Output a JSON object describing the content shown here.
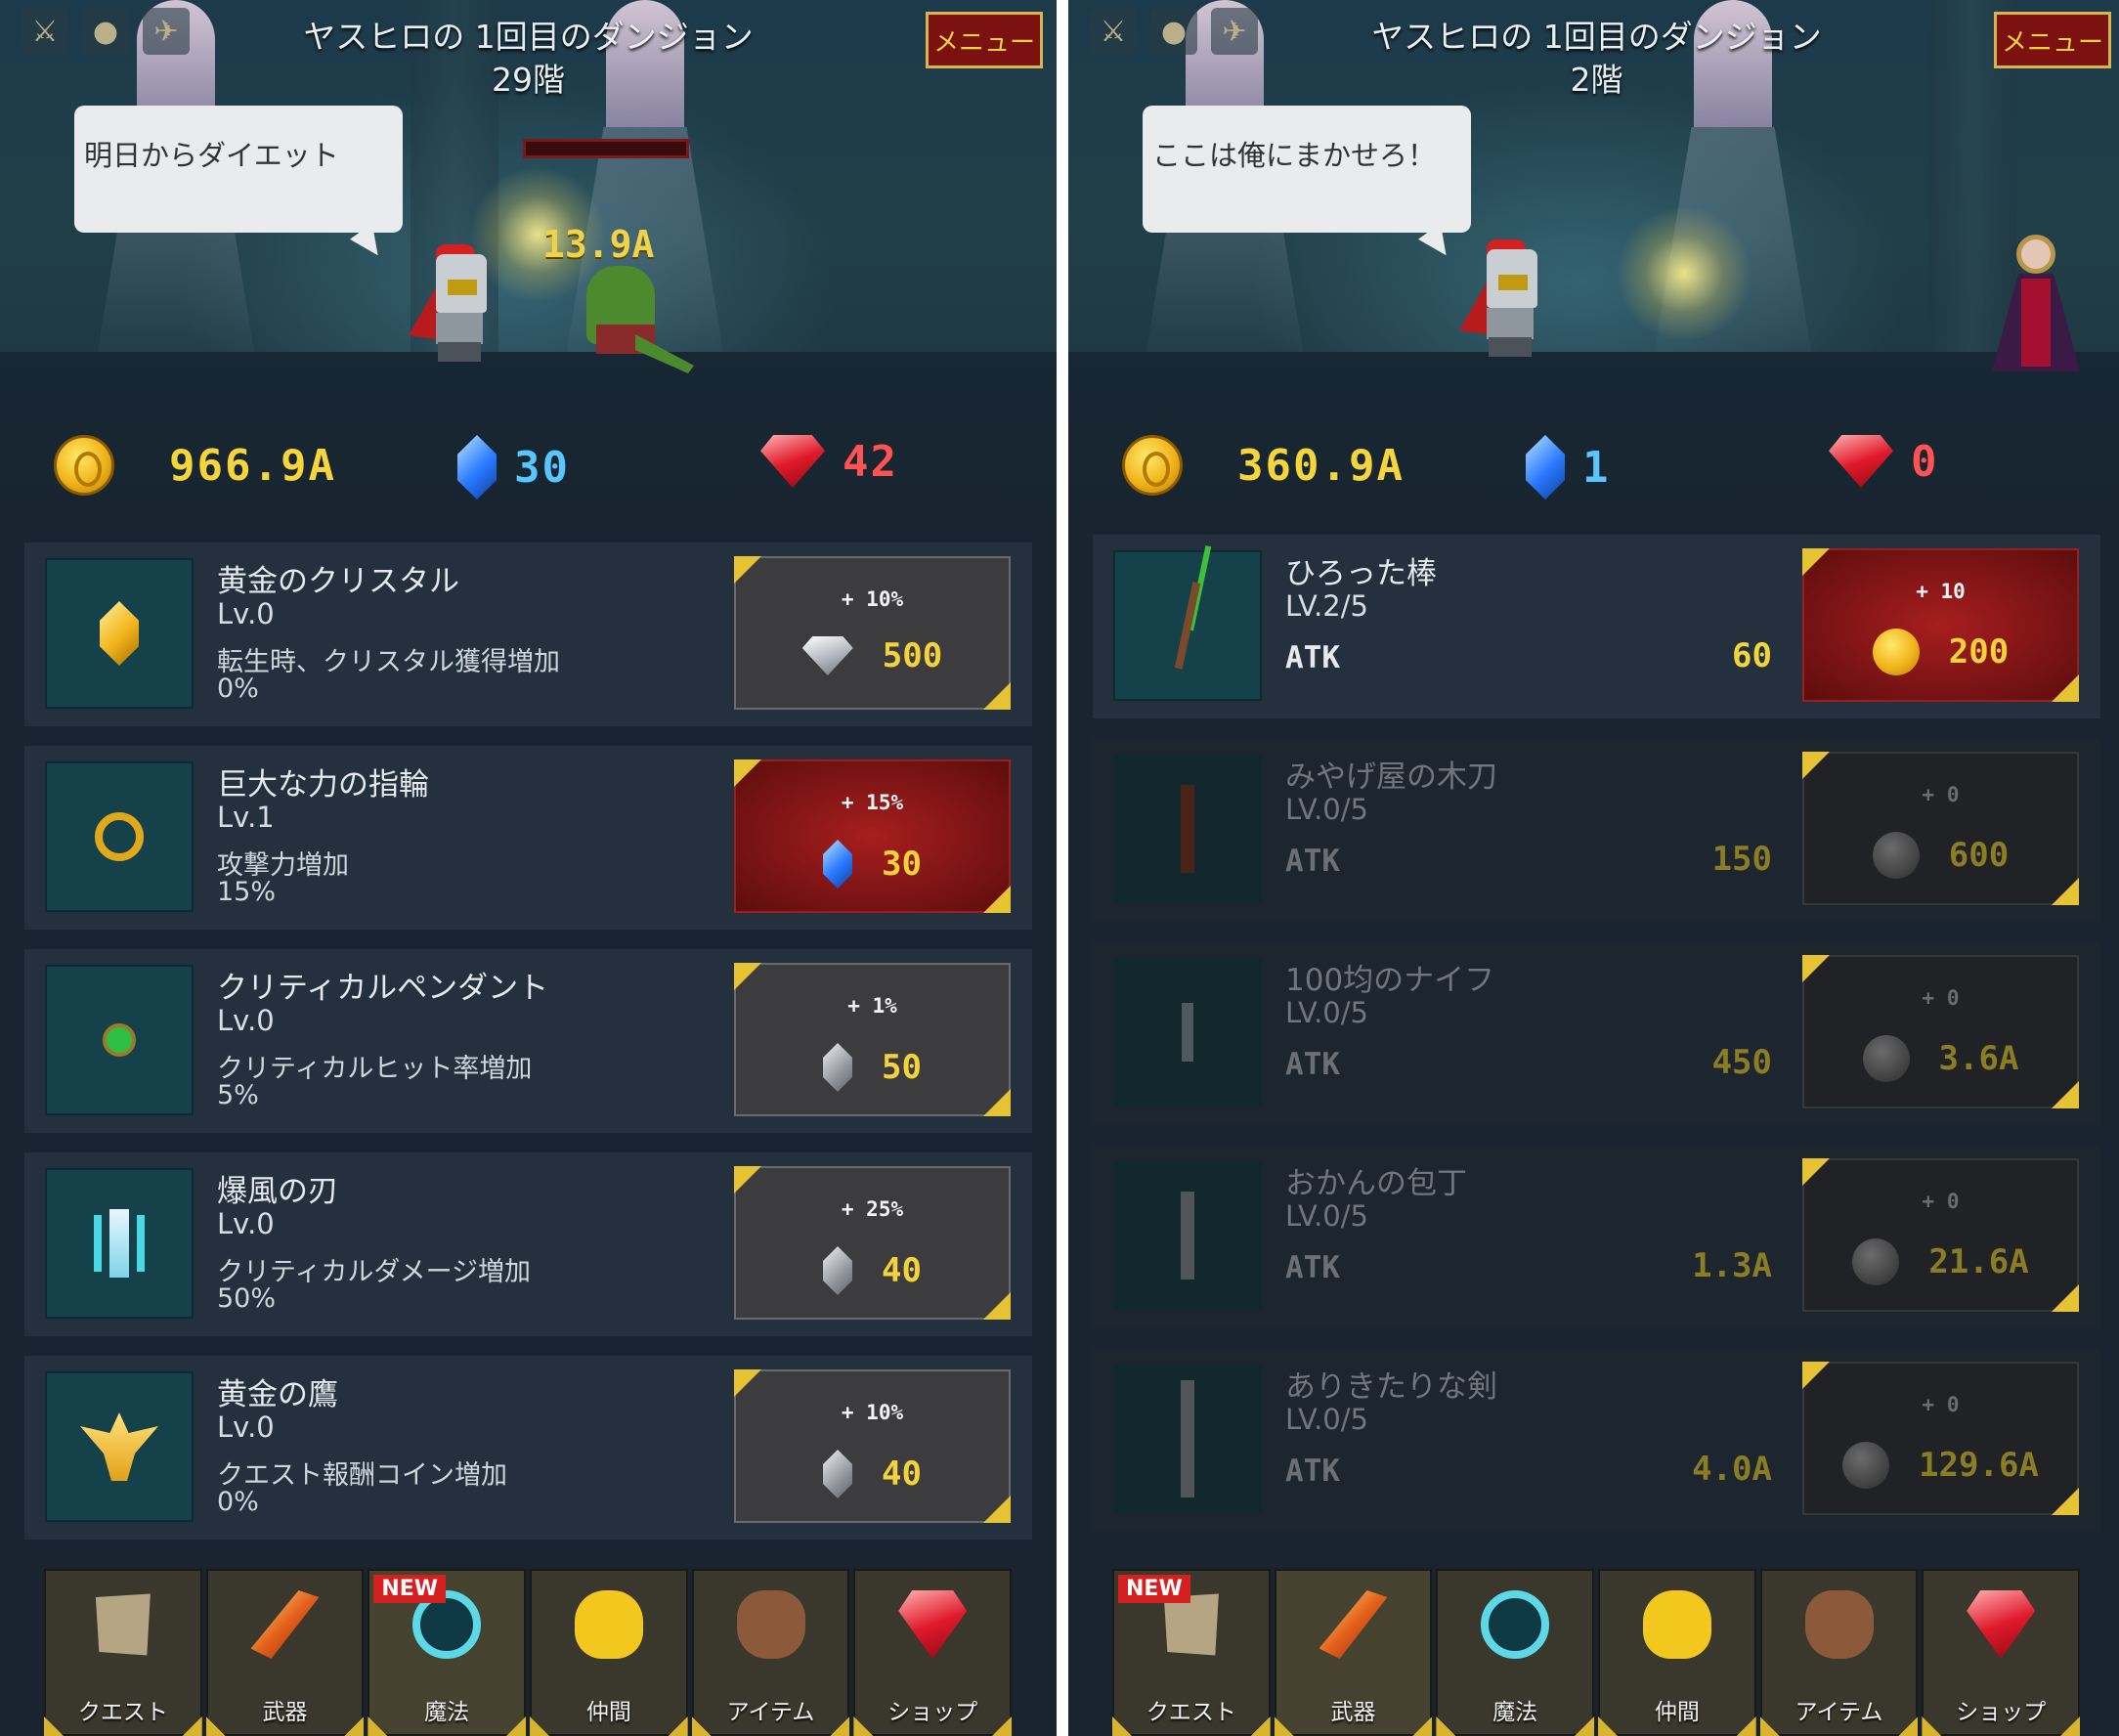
{
  "left": {
    "title_line1": "ヤスヒロの 1回目のダンジョン",
    "title_line2": "29階",
    "menu_label": "メニュー",
    "speech": "明日からダイエット",
    "damage": "13.9A",
    "gold": "966.9A",
    "crystals": "30",
    "rubies": "42",
    "items": [
      {
        "name": "黄金のクリスタル",
        "level": "Lv.0",
        "desc": "転生時、クリスタル獲得増加",
        "value": "0%",
        "bonus": "+ 10%",
        "cost": "500",
        "icon": "gold-crystal-icon"
      },
      {
        "name": "巨大な力の指輪",
        "level": "Lv.1",
        "desc": "攻撃力増加",
        "value": "15%",
        "bonus": "+ 15%",
        "cost": "30",
        "icon": "ring-icon"
      },
      {
        "name": "クリティカルペンダント",
        "level": "Lv.0",
        "desc": "クリティカルヒット率増加",
        "value": "5%",
        "bonus": "+ 1%",
        "cost": "50",
        "icon": "pendant-icon"
      },
      {
        "name": "爆風の刃",
        "level": "Lv.0",
        "desc": "クリティカルダメージ増加",
        "value": "50%",
        "bonus": "+ 25%",
        "cost": "40",
        "icon": "blade-icon"
      },
      {
        "name": "黄金の鷹",
        "level": "Lv.0",
        "desc": "クエスト報酬コイン増加",
        "value": "0%",
        "bonus": "+ 10%",
        "cost": "40",
        "icon": "golden-hawk-icon"
      }
    ],
    "new_badge": "NEW"
  },
  "right": {
    "title_line1": "ヤスヒロの 1回目のダンジョン",
    "title_line2": "2階",
    "menu_label": "メニュー",
    "speech": "ここは俺にまかせろ！",
    "gold": "360.9A",
    "crystals": "1",
    "rubies": "0",
    "atk_label": "ATK",
    "weapons": [
      {
        "name": "ひろった棒",
        "level": "LV.2/5",
        "atk": "60",
        "bonus": "+ 10",
        "cost": "200",
        "icon": "stick-icon"
      },
      {
        "name": "みやげ屋の木刀",
        "level": "LV.0/5",
        "atk": "150",
        "bonus": "+ 0",
        "cost": "600",
        "icon": "wooden-sword-icon"
      },
      {
        "name": "100均のナイフ",
        "level": "LV.0/5",
        "atk": "450",
        "bonus": "+ 0",
        "cost": "3.6A",
        "icon": "knife-icon"
      },
      {
        "name": "おかんの包丁",
        "level": "LV.0/5",
        "atk": "1.3A",
        "bonus": "+ 0",
        "cost": "21.6A",
        "icon": "kitchen-knife-icon"
      },
      {
        "name": "ありきたりな剣",
        "level": "LV.0/5",
        "atk": "4.0A",
        "bonus": "+ 0",
        "cost": "129.6A",
        "icon": "sword-icon"
      }
    ],
    "new_badge": "NEW"
  },
  "nav": [
    {
      "label": "クエスト",
      "icon": "scroll-icon"
    },
    {
      "label": "武器",
      "icon": "flame-sword-icon"
    },
    {
      "label": "魔法",
      "icon": "magic-circle-icon"
    },
    {
      "label": "仲間",
      "icon": "chick-icon"
    },
    {
      "label": "アイテム",
      "icon": "bag-icon"
    },
    {
      "label": "ショップ",
      "icon": "ruby-icon"
    }
  ]
}
